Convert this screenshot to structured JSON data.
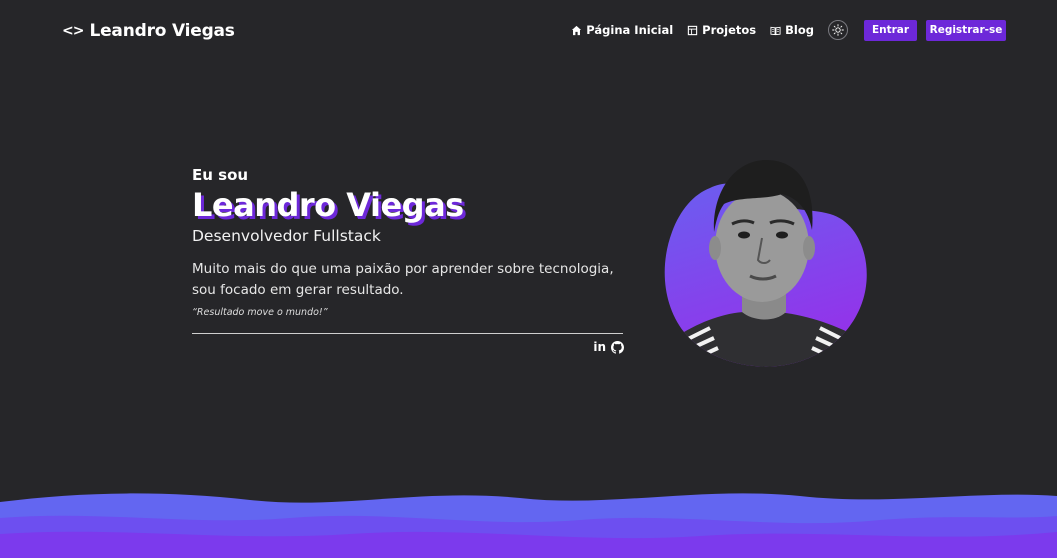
{
  "header": {
    "logo_mark": "<>",
    "logo_text": "Leandro Viegas",
    "nav": [
      {
        "label": "Página Inicial",
        "icon": "home-icon"
      },
      {
        "label": "Projetos",
        "icon": "projects-icon"
      },
      {
        "label": "Blog",
        "icon": "book-icon"
      }
    ],
    "theme_icon": "sun-icon",
    "login_label": "Entrar",
    "register_label": "Registrar-se"
  },
  "hero": {
    "intro": "Eu sou",
    "name": "Leandro Viegas",
    "role": "Desenvolvedor Fullstack",
    "description": "Muito mais do que uma paixão por aprender sobre tecnologia, sou focado em gerar resultado.",
    "quote": "“Resultado move o mundo!”",
    "social": [
      {
        "label": "in",
        "icon": "linkedin-icon"
      },
      {
        "icon": "github-icon"
      }
    ]
  },
  "colors": {
    "background": "#262629",
    "accent": "#6d28d9",
    "blob_top": "#6366f1",
    "blob_bottom": "#9333ea",
    "wave_light": "#6366f1",
    "wave_dark": "#7c3aed"
  }
}
